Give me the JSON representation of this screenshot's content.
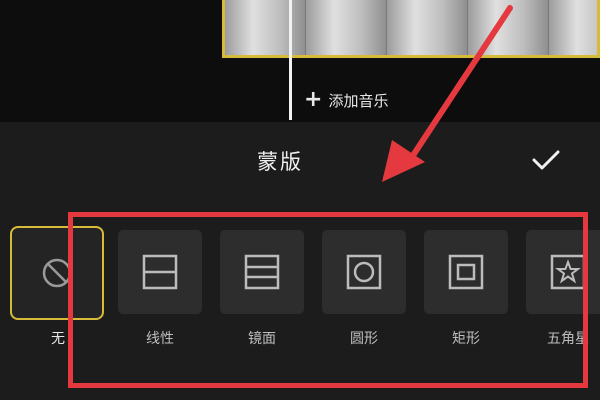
{
  "timeline": {
    "add_music_label": "添加音乐"
  },
  "panel": {
    "title": "蒙版",
    "confirm_icon": "checkmark-icon"
  },
  "masks": [
    {
      "label": "无",
      "icon": "none-icon",
      "selected": true
    },
    {
      "label": "线性",
      "icon": "linear-mask-icon",
      "selected": false
    },
    {
      "label": "镜面",
      "icon": "mirror-mask-icon",
      "selected": false
    },
    {
      "label": "圆形",
      "icon": "circle-mask-icon",
      "selected": false
    },
    {
      "label": "矩形",
      "icon": "rectangle-mask-icon",
      "selected": false
    },
    {
      "label": "五角星",
      "icon": "star-mask-icon",
      "selected": false
    }
  ],
  "colors": {
    "accent_selected": "#d6bb3a",
    "annotation": "#e43a3f"
  }
}
